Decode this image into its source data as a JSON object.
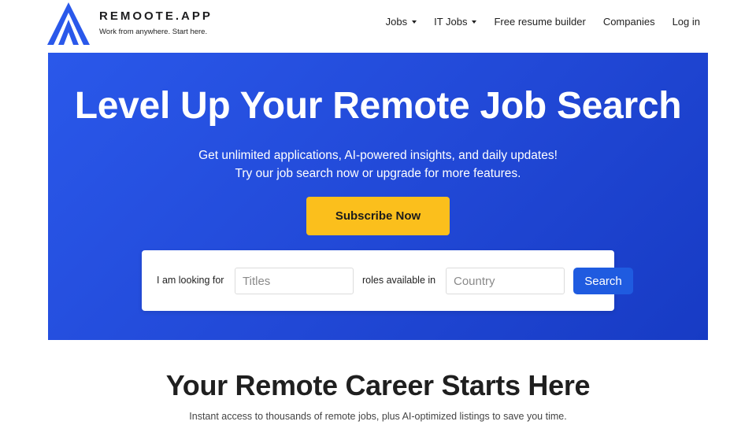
{
  "brand": {
    "name": "REMOOTE.APP",
    "tagline": "Work from anywhere. Start here.",
    "logo_icon": "mountain-peak-logo",
    "accent_color": "#2a58ea"
  },
  "nav": {
    "items": [
      {
        "label": "Jobs",
        "has_dropdown": true
      },
      {
        "label": "IT Jobs",
        "has_dropdown": true
      },
      {
        "label": "Free resume builder",
        "has_dropdown": false
      },
      {
        "label": "Companies",
        "has_dropdown": false
      },
      {
        "label": "Log in",
        "has_dropdown": false
      }
    ]
  },
  "hero": {
    "title": "Level Up Your Remote Job Search",
    "subtitle_line1": "Get unlimited applications, AI-powered insights, and daily updates!",
    "subtitle_line2": "Try our job search now or upgrade for more features.",
    "subscribe_label": "Subscribe Now",
    "subscribe_color": "#fbbf1c",
    "background_color": "#2148d6"
  },
  "search": {
    "label_looking_for": "I am looking for",
    "titles_placeholder": "Titles",
    "titles_value": "",
    "label_roles": "roles available in",
    "country_placeholder": "Country",
    "country_value": "",
    "button_label": "Search",
    "button_color": "#1f5be0"
  },
  "section": {
    "title": "Your Remote Career Starts Here",
    "subtitle": "Instant access to thousands of remote jobs, plus AI-optimized listings to save you time."
  }
}
